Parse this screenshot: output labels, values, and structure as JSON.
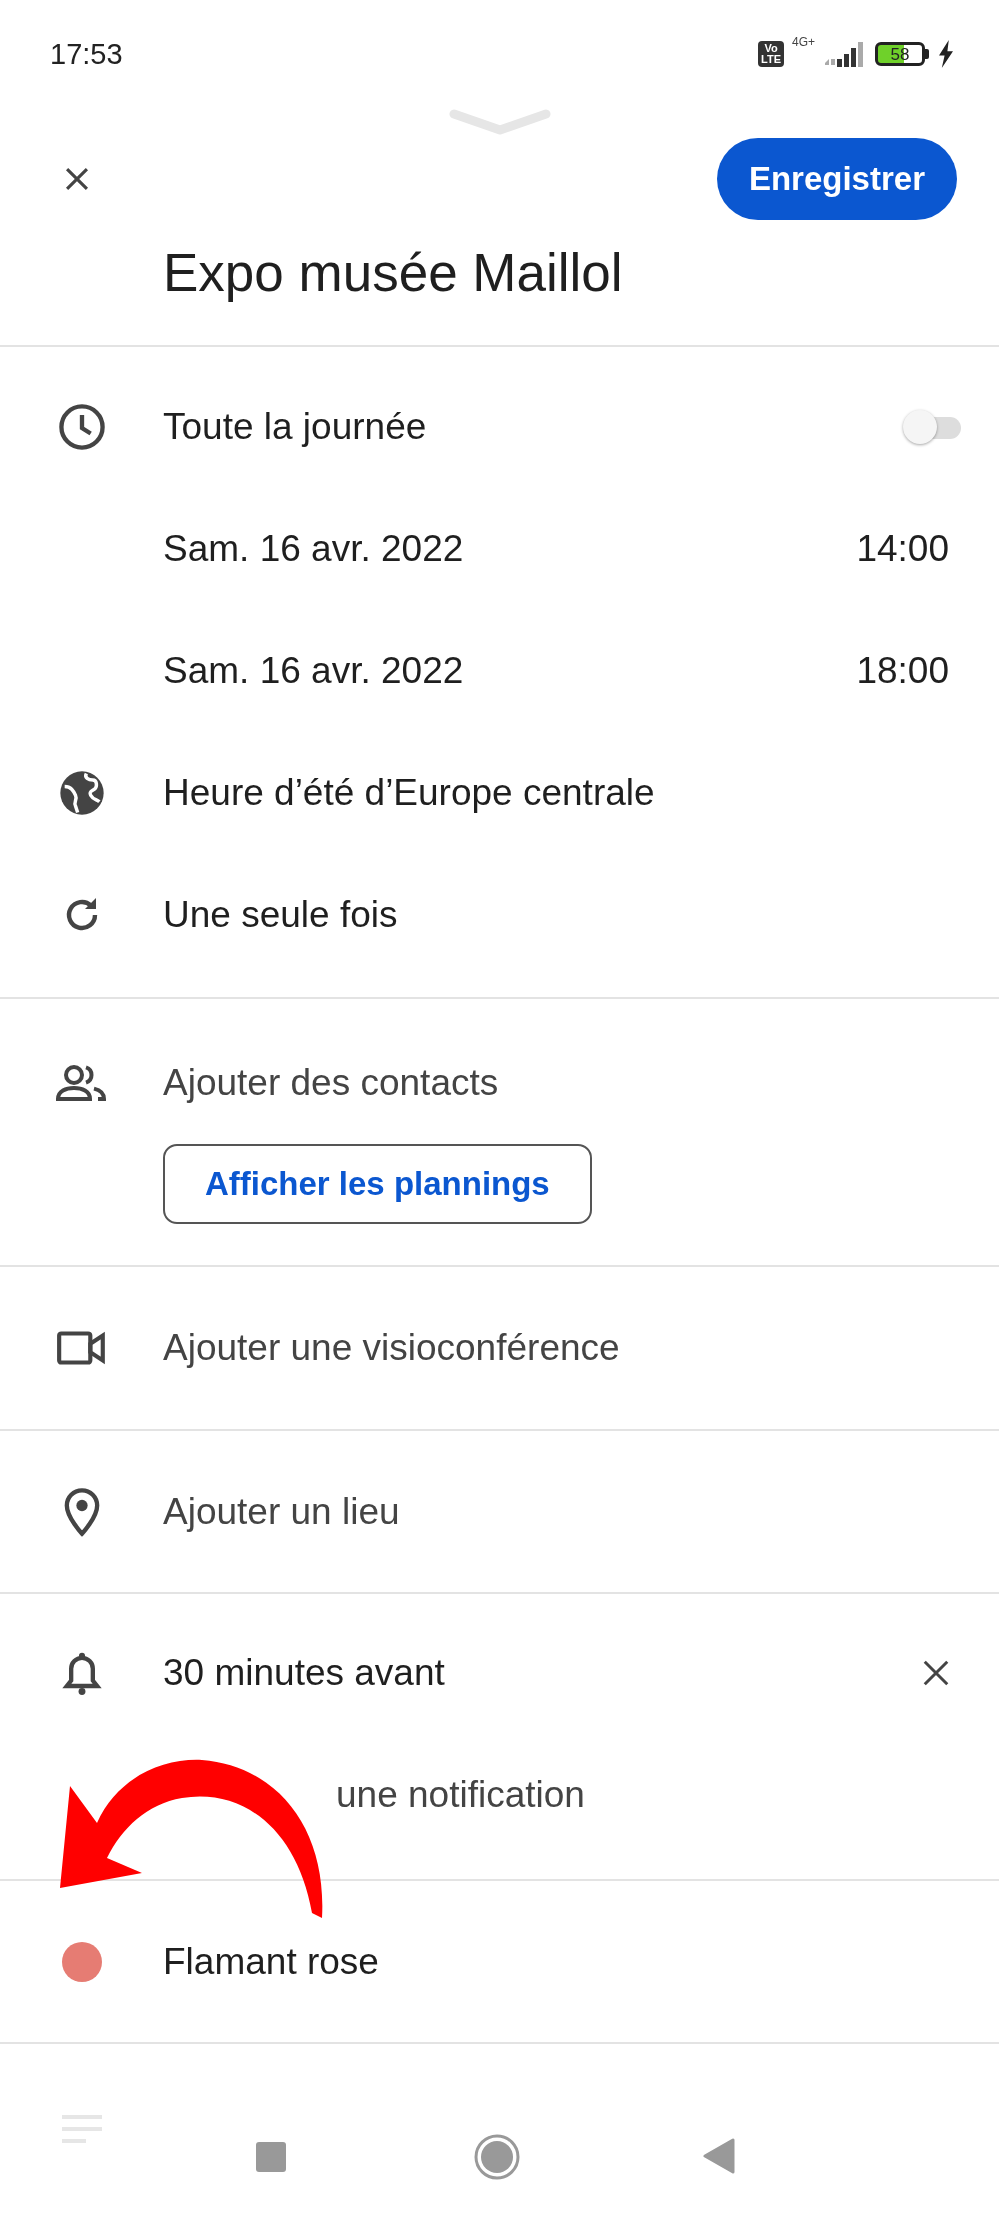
{
  "status_bar": {
    "time": "17:53",
    "volte": [
      "Vo",
      "LTE"
    ],
    "network": "4G+",
    "battery": "58"
  },
  "header": {
    "save_button": "Enregistrer",
    "title": "Expo musée Maillol"
  },
  "all_day": {
    "label": "Toute la journée",
    "on": false
  },
  "start": {
    "date": "Sam. 16 avr. 2022",
    "time": "14:00"
  },
  "end": {
    "date": "Sam. 16 avr. 2022",
    "time": "18:00"
  },
  "timezone": "Heure d’été d’Europe centrale",
  "recurrence": "Une seule fois",
  "guests": {
    "label": "Ajouter des contacts",
    "schedule_button": "Afficher les plannings"
  },
  "conference": "Ajouter une visioconférence",
  "location": "Ajouter un lieu",
  "notifications": [
    {
      "label": "30 minutes avant"
    }
  ],
  "add_notification": "une notification",
  "calendar": {
    "name": "Flamant rose",
    "color": "#e67c73"
  }
}
